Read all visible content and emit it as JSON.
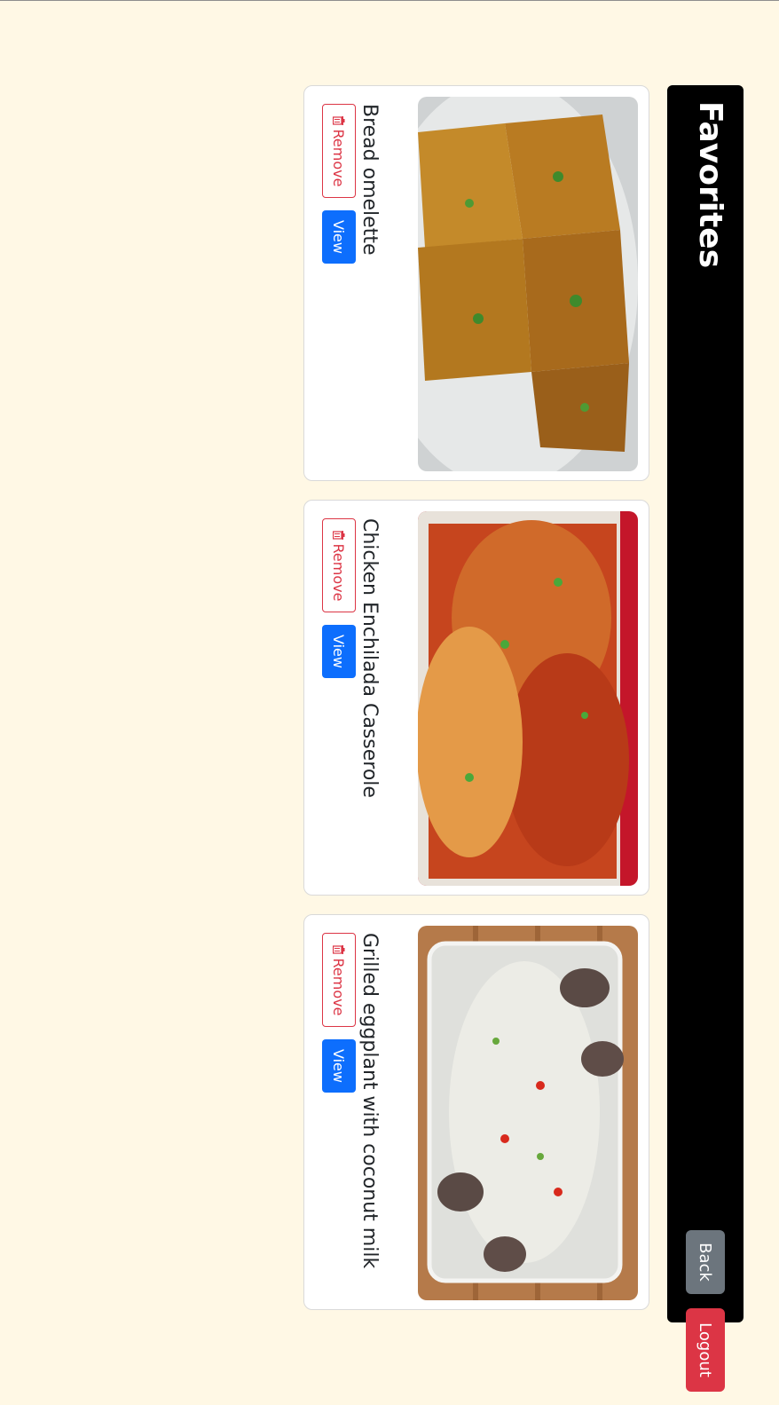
{
  "header": {
    "title": "Favorites",
    "back_label": "Back",
    "logout_label": "Logout",
    "background": "#000000"
  },
  "favorites": [
    {
      "title": "Bread omelette",
      "image": "bread-omelette-photo",
      "view_label": "View",
      "remove_label": "Remove"
    },
    {
      "title": "Chicken Enchilada Casserole",
      "image": "chicken-enchilada-casserole-photo",
      "view_label": "View",
      "remove_label": "Remove"
    },
    {
      "title": "Grilled eggplant with coconut milk",
      "image": "grilled-eggplant-photo",
      "view_label": "View",
      "remove_label": "Remove"
    }
  ],
  "colors": {
    "page_background": "#fff8e5",
    "primary": "#0d6efd",
    "danger": "#dc3545",
    "secondary": "#6c757d"
  }
}
